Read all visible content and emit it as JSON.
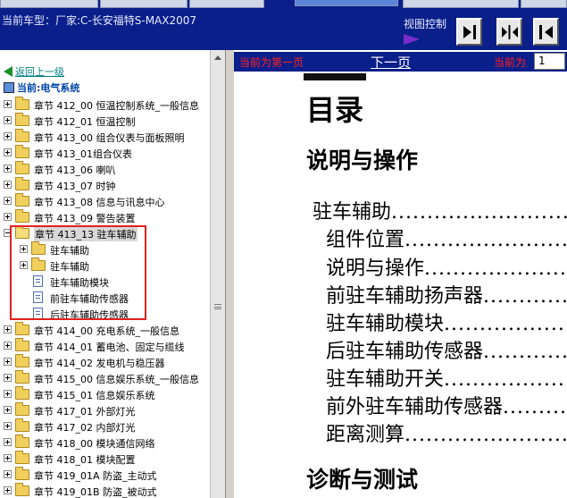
{
  "header": {
    "car_model": "当前车型：厂家:C-长安福特S-MAX2007",
    "view_control": "视图控制"
  },
  "colors": {
    "header_bg": "#0b1f8a",
    "highlight_box": "#e02020",
    "link_teal": "#008080",
    "red_text": "#ff2020"
  },
  "sidebar": {
    "back_link": "返回上一级",
    "current_system": "当前:电气系统",
    "items": [
      {
        "label": "章节 412_00 恒温控制系统_一般信息",
        "icon": "folder-icon",
        "expander": "plus"
      },
      {
        "label": "章节 412_01 恒温控制",
        "icon": "folder-icon",
        "expander": "plus"
      },
      {
        "label": "章节 413_00 组合仪表与面板照明",
        "icon": "folder-icon",
        "expander": "plus"
      },
      {
        "label": "章节 413_01组合仪表",
        "icon": "folder-icon",
        "expander": "plus"
      },
      {
        "label": "章节 413_06 喇叭",
        "icon": "folder-icon",
        "expander": "plus"
      },
      {
        "label": "章节 413_07 时钟",
        "icon": "folder-icon",
        "expander": "plus"
      },
      {
        "label": "章节 413_08 信息与讯息中心",
        "icon": "folder-icon",
        "expander": "plus"
      },
      {
        "label": "章节 413_09 警告装置",
        "icon": "folder-icon",
        "expander": "plus"
      },
      {
        "label": "章节 413_13 驻车辅助",
        "icon": "folder-open-icon",
        "expander": "minus",
        "selected": true
      },
      {
        "label": "驻车辅助",
        "icon": "folder-icon",
        "expander": "plus",
        "child": true
      },
      {
        "label": "驻车辅助",
        "icon": "folder-icon",
        "expander": "plus",
        "child": true
      },
      {
        "label": "驻车辅助模块",
        "icon": "document-icon",
        "child": true
      },
      {
        "label": "前驻车辅助传感器",
        "icon": "document-icon",
        "child": true
      },
      {
        "label": "后驻车辅助传感器",
        "icon": "document-icon",
        "child": true
      },
      {
        "label": "章节 414_00 充电系统_一般信息",
        "icon": "folder-icon",
        "expander": "plus"
      },
      {
        "label": "章节 414_01 蓄电池、固定与缆线",
        "icon": "folder-icon",
        "expander": "plus"
      },
      {
        "label": "章节 414_02 发电机与稳压器",
        "icon": "folder-icon",
        "expander": "plus"
      },
      {
        "label": "章节 415_00 信息娱乐系统_一般信息",
        "icon": "folder-icon",
        "expander": "plus"
      },
      {
        "label": "章节 415_01 信息娱乐系统",
        "icon": "folder-icon",
        "expander": "plus"
      },
      {
        "label": "章节 417_01 外部灯光",
        "icon": "folder-icon",
        "expander": "plus"
      },
      {
        "label": "章节 417_02 内部灯光",
        "icon": "folder-icon",
        "expander": "plus"
      },
      {
        "label": "章节 418_00 模块通信网络",
        "icon": "folder-icon",
        "expander": "plus"
      },
      {
        "label": "章节 418_01 模块配置",
        "icon": "folder-icon",
        "expander": "plus"
      },
      {
        "label": "章节 419_01A 防盗_主动式",
        "icon": "folder-icon",
        "expander": "plus"
      },
      {
        "label": "章节 419_01B 防盗_被动式",
        "icon": "folder-icon",
        "expander": "plus"
      }
    ]
  },
  "doc_nav": {
    "first_page_notice": "当前为第一页",
    "next_page": "下一页",
    "current_label": "当前为",
    "page_value": "1"
  },
  "document": {
    "toc_title": "目录",
    "section1": "说明与操作",
    "section2": "诊断与测试",
    "entries": [
      {
        "text": "驻车辅助"
      },
      {
        "text": "组件位置"
      },
      {
        "text": "说明与操作"
      },
      {
        "text": "前驻车辅助扬声器"
      },
      {
        "text": "驻车辅助模块"
      },
      {
        "text": "后驻车辅助传感器"
      },
      {
        "text": "驻车辅助开关"
      },
      {
        "text": "前外驻车辅助传感器"
      },
      {
        "text": "距离测算"
      }
    ]
  }
}
